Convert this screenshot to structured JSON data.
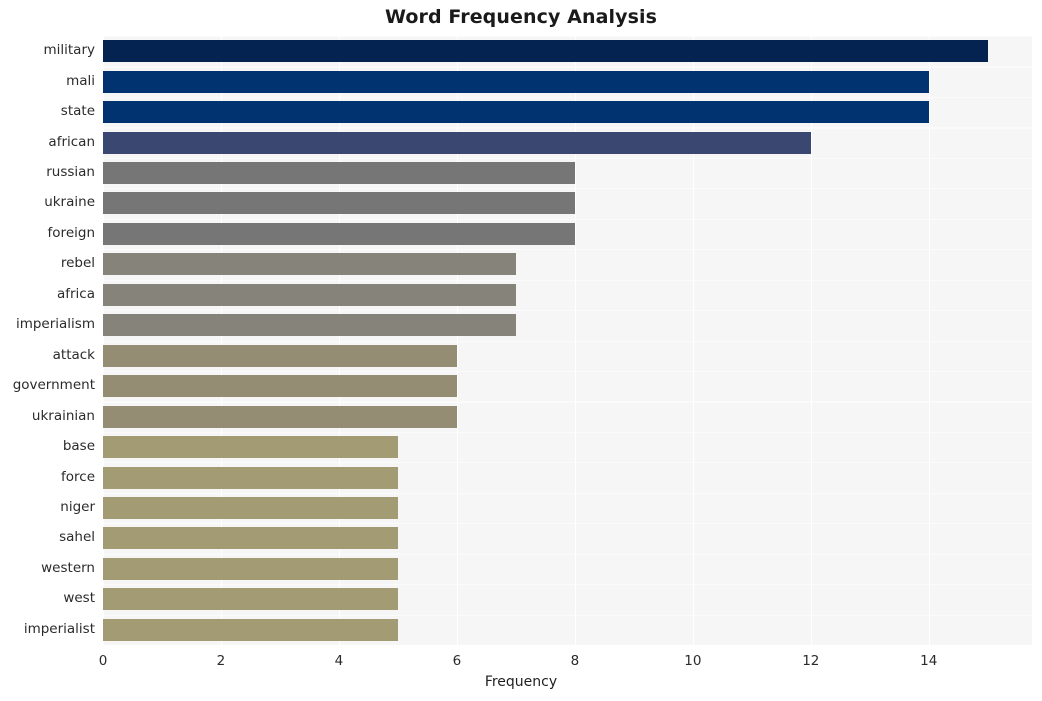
{
  "chart_data": {
    "type": "bar",
    "orientation": "horizontal",
    "title": "Word Frequency Analysis",
    "xlabel": "Frequency",
    "ylabel": "",
    "xlim": [
      0,
      15.75
    ],
    "ylim_categories_top_to_bottom": true,
    "xticks": [
      0,
      2,
      4,
      6,
      8,
      10,
      12,
      14
    ],
    "xticklabels": [
      "0",
      "2",
      "4",
      "6",
      "8",
      "10",
      "12",
      "14"
    ],
    "grid": "vertical-white-on-light-gray",
    "legend": "none",
    "categories": [
      "military",
      "mali",
      "state",
      "african",
      "russian",
      "ukraine",
      "foreign",
      "rebel",
      "africa",
      "imperialism",
      "attack",
      "government",
      "ukrainian",
      "base",
      "force",
      "niger",
      "sahel",
      "western",
      "west",
      "imperialist"
    ],
    "values": [
      15,
      14,
      14,
      12,
      8,
      8,
      8,
      7,
      7,
      7,
      6,
      6,
      6,
      5,
      5,
      5,
      5,
      5,
      5,
      5
    ],
    "bar_colors": [
      "#042350",
      "#003370",
      "#003370",
      "#3a4871",
      "#767676",
      "#767676",
      "#767676",
      "#85837a",
      "#85837a",
      "#85837a",
      "#948d73",
      "#948d73",
      "#948d73",
      "#a39b74",
      "#a39b74",
      "#a39b74",
      "#a39b74",
      "#a39b74",
      "#a39b74",
      "#a39b74"
    ],
    "plot_background": "#f6f6f6",
    "figure_background": "#ffffff",
    "gridline_color": "#ffffff",
    "title_color": "#1a1a1a",
    "tick_label_color": "#2b2b2b"
  }
}
